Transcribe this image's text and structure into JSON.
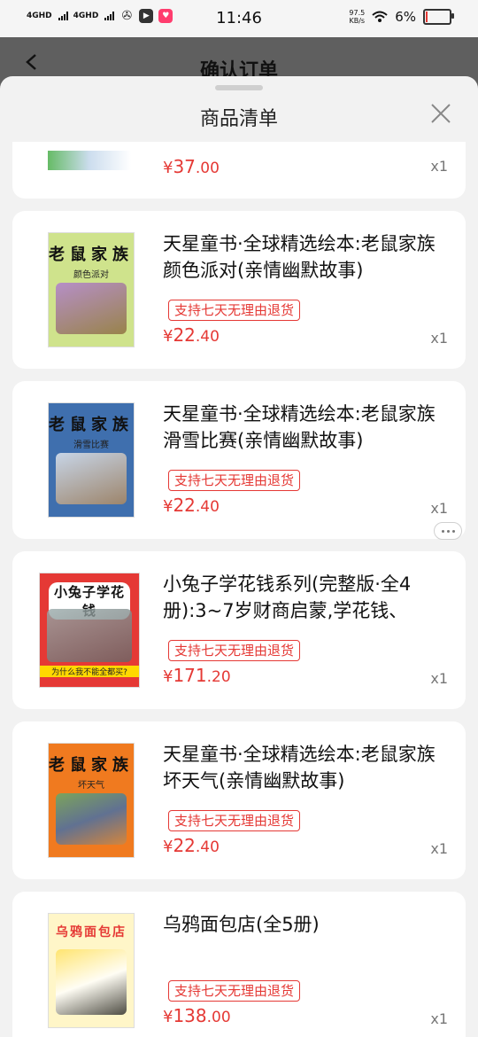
{
  "status_bar": {
    "sim1": "4GHD",
    "sim2": "4GHD",
    "time": "11:46",
    "speed_value": "97.5",
    "speed_unit": "KB/s",
    "battery_text": "6%",
    "battery_level": 0.06
  },
  "page": {
    "title": "确认订单"
  },
  "sheet": {
    "title": "商品清单"
  },
  "items": [
    {
      "title": "",
      "tag": "",
      "price_symbol": "¥",
      "price_int": "37",
      "price_frac": ".00",
      "qty": "x1"
    },
    {
      "title": "天星童书·全球精选绘本:老鼠家族 颜色派对(亲情幽默故事)",
      "tag": "支持七天无理由退货",
      "price_symbol": "¥",
      "price_int": "22",
      "price_frac": ".40",
      "qty": "x1",
      "cover_title": "老鼠家族",
      "cover_sub": "颜色派对"
    },
    {
      "title": "天星童书·全球精选绘本:老鼠家族 滑雪比赛(亲情幽默故事)",
      "tag": "支持七天无理由退货",
      "price_symbol": "¥",
      "price_int": "22",
      "price_frac": ".40",
      "qty": "x1",
      "cover_title": "老鼠家族",
      "cover_sub": "滑雪比赛"
    },
    {
      "title": "小兔子学花钱系列(完整版·全4册):3~7岁财商启蒙,学花钱、",
      "tag": "支持七天无理由退货",
      "price_symbol": "¥",
      "price_int": "171",
      "price_frac": ".20",
      "qty": "x1",
      "cover_title": "小兔子学花钱",
      "cover_sub": "为什么我不能全都买?"
    },
    {
      "title": "天星童书·全球精选绘本:老鼠家族 坏天气(亲情幽默故事)",
      "tag": "支持七天无理由退货",
      "price_symbol": "¥",
      "price_int": "22",
      "price_frac": ".40",
      "qty": "x1",
      "cover_title": "老鼠家族",
      "cover_sub": "坏天气"
    },
    {
      "title": "乌鸦面包店(全5册)",
      "tag": "支持七天无理由退货",
      "price_symbol": "¥",
      "price_int": "138",
      "price_frac": ".00",
      "qty": "x1",
      "cover_title": "乌鸦面包店",
      "cover_sub": ""
    }
  ],
  "colors": {
    "accent": "#e53935",
    "overlay": "#5f5f5f"
  }
}
